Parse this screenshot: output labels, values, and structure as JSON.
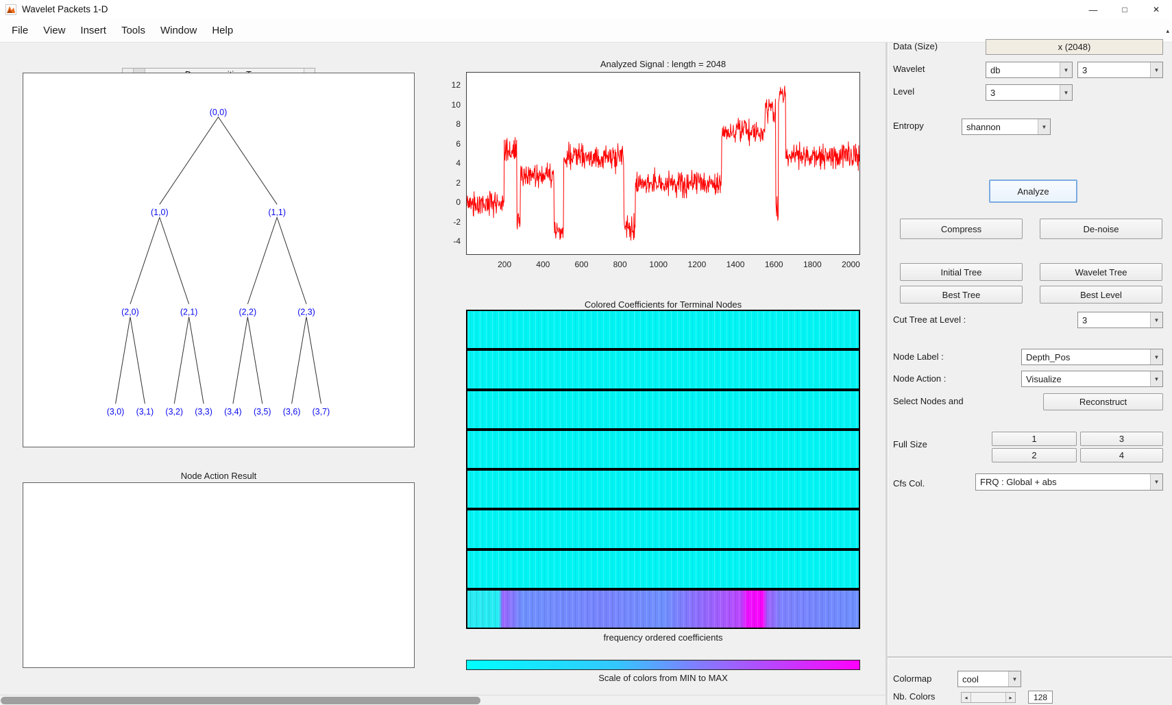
{
  "window": {
    "title": "Wavelet Packets 1-D",
    "minimize_glyph": "—",
    "maximize_glyph": "□",
    "close_glyph": "✕"
  },
  "icons": {
    "combo_arrow": "▼",
    "scroll_left": "◂",
    "scroll_right": "▸",
    "corner": "▴"
  },
  "menu": {
    "items": [
      "File",
      "View",
      "Insert",
      "Tools",
      "Window",
      "Help"
    ]
  },
  "tree_panel": {
    "title": "Decomposition Tree",
    "node_color": "#0808f0",
    "nodes": [
      {
        "depth": 0,
        "pos": 0,
        "label": "(0,0)"
      },
      {
        "depth": 1,
        "pos": 0,
        "label": "(1,0)"
      },
      {
        "depth": 1,
        "pos": 1,
        "label": "(1,1)"
      },
      {
        "depth": 2,
        "pos": 0,
        "label": "(2,0)"
      },
      {
        "depth": 2,
        "pos": 1,
        "label": "(2,1)"
      },
      {
        "depth": 2,
        "pos": 2,
        "label": "(2,2)"
      },
      {
        "depth": 2,
        "pos": 3,
        "label": "(2,3)"
      },
      {
        "depth": 3,
        "pos": 0,
        "label": "(3,0)"
      },
      {
        "depth": 3,
        "pos": 1,
        "label": "(3,1)"
      },
      {
        "depth": 3,
        "pos": 2,
        "label": "(3,2)"
      },
      {
        "depth": 3,
        "pos": 3,
        "label": "(3,3)"
      },
      {
        "depth": 3,
        "pos": 4,
        "label": "(3,4)"
      },
      {
        "depth": 3,
        "pos": 5,
        "label": "(3,5)"
      },
      {
        "depth": 3,
        "pos": 6,
        "label": "(3,6)"
      },
      {
        "depth": 3,
        "pos": 7,
        "label": "(3,7)"
      }
    ]
  },
  "node_action_panel": {
    "title": "Node Action Result"
  },
  "chart_data": [
    {
      "type": "line",
      "title": "Analyzed Signal : length = 2048",
      "x_ticks": [
        200,
        400,
        600,
        800,
        1000,
        1200,
        1400,
        1600,
        1800,
        2000
      ],
      "y_ticks": [
        12,
        10,
        8,
        6,
        4,
        2,
        0,
        -2,
        -4
      ],
      "xlim": [
        0,
        2048
      ],
      "ylim": [
        -5.3,
        13.4
      ],
      "line_color": "#ff0000",
      "noise_amplitude": 1.3,
      "segments": [
        {
          "x0": 0,
          "x1": 195,
          "level": 0
        },
        {
          "x0": 195,
          "x1": 262,
          "level": 5.5
        },
        {
          "x0": 262,
          "x1": 280,
          "level": -1.8
        },
        {
          "x0": 280,
          "x1": 455,
          "level": 2.9
        },
        {
          "x0": 455,
          "x1": 505,
          "level": -2.9
        },
        {
          "x0": 505,
          "x1": 820,
          "level": 4.7
        },
        {
          "x0": 820,
          "x1": 880,
          "level": -2.5
        },
        {
          "x0": 880,
          "x1": 1330,
          "level": 2.0
        },
        {
          "x0": 1330,
          "x1": 1555,
          "level": 7.4
        },
        {
          "x0": 1555,
          "x1": 1612,
          "level": 9.7
        },
        {
          "x0": 1612,
          "x1": 1625,
          "level": -0.8
        },
        {
          "x0": 1625,
          "x1": 1663,
          "level": 11.2
        },
        {
          "x0": 1663,
          "x1": 2048,
          "level": 4.8
        }
      ]
    },
    {
      "type": "heatmap",
      "title": "Colored Coefficients for Terminal Nodes",
      "caption": "frequency ordered coefficients",
      "rows": 8,
      "uniform_row_color": "#00f4f4",
      "bottom_row_stops": [
        {
          "at": 0.0,
          "color": "#2ae9f2"
        },
        {
          "at": 0.08,
          "color": "#25ecf4"
        },
        {
          "at": 0.09,
          "color": "#9a64ff"
        },
        {
          "at": 0.11,
          "color": "#8a74ff"
        },
        {
          "at": 0.14,
          "color": "#6e90ff"
        },
        {
          "at": 0.36,
          "color": "#7884ff"
        },
        {
          "at": 0.5,
          "color": "#6e90ff"
        },
        {
          "at": 0.6,
          "color": "#9169ff"
        },
        {
          "at": 0.65,
          "color": "#a55cff"
        },
        {
          "at": 0.7,
          "color": "#bb44ff"
        },
        {
          "at": 0.715,
          "color": "#ee11ff"
        },
        {
          "at": 0.755,
          "color": "#fa05fa"
        },
        {
          "at": 0.765,
          "color": "#a05eff"
        },
        {
          "at": 0.8,
          "color": "#7d82ff"
        },
        {
          "at": 0.9,
          "color": "#7487ff"
        },
        {
          "at": 1.0,
          "color": "#6e90ff"
        }
      ]
    },
    {
      "type": "colorbar",
      "caption": "Scale of colors from MIN to MAX",
      "stops": [
        {
          "at": 0.0,
          "color": "#00ffff"
        },
        {
          "at": 0.38,
          "color": "#33c7ff"
        },
        {
          "at": 0.58,
          "color": "#7f80ff"
        },
        {
          "at": 0.8,
          "color": "#c13eff"
        },
        {
          "at": 1.0,
          "color": "#ff00ff"
        }
      ]
    }
  ],
  "controls": {
    "data_label": "Data (Size)",
    "data_value": "x (2048)",
    "wavelet_label": "Wavelet",
    "wavelet_family": "db",
    "wavelet_number": "3",
    "level_label": "Level",
    "level_value": "3",
    "entropy_label": "Entropy",
    "entropy_value": "shannon",
    "analyze": "Analyze",
    "compress": "Compress",
    "denoise": "De-noise",
    "initial_tree": "Initial Tree",
    "wavelet_tree": "Wavelet Tree",
    "best_tree": "Best Tree",
    "best_level": "Best Level",
    "cut_tree_label": "Cut Tree at Level :",
    "cut_tree_value": "3",
    "node_label_label": "Node Label :",
    "node_label_value": "Depth_Pos",
    "node_action_label": "Node Action :",
    "node_action_value": "Visualize",
    "select_nodes_label": "Select Nodes and",
    "reconstruct": "Reconstruct",
    "full_size_label": "Full Size",
    "full_size_buttons": [
      "1",
      "3",
      "2",
      "4"
    ],
    "cfs_col_label": "Cfs Col.",
    "cfs_col_value": "FRQ : Global + abs",
    "colormap_label": "Colormap",
    "colormap_value": "cool",
    "nb_colors_label": "Nb. Colors",
    "nb_colors_value": "128"
  }
}
